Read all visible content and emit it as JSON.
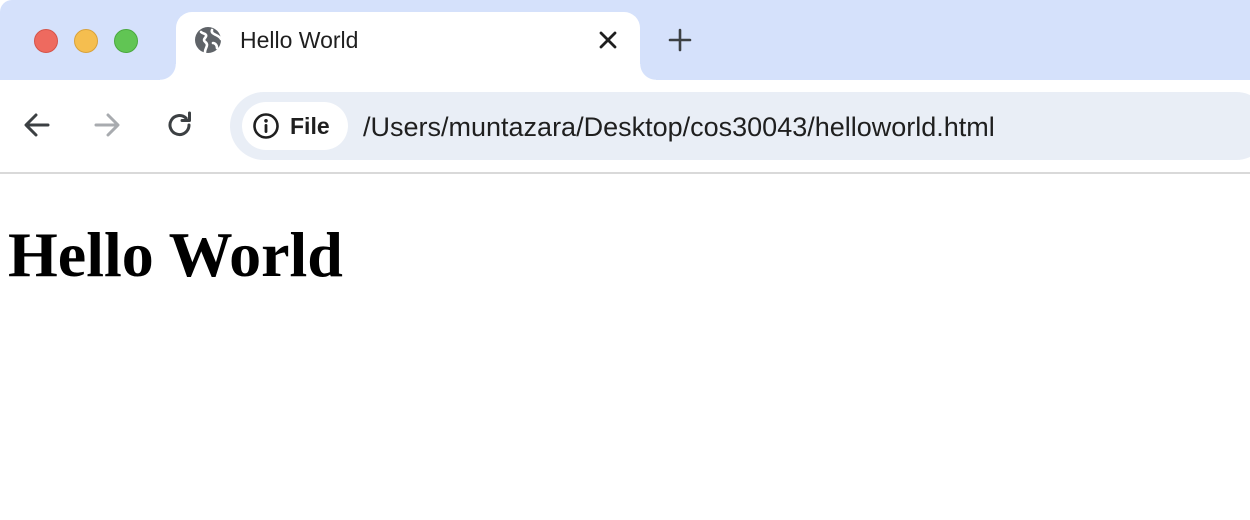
{
  "tab": {
    "title": "Hello World",
    "favicon": "globe-icon"
  },
  "toolbar": {
    "back_icon": "arrow-left-icon",
    "forward_icon": "arrow-right-icon",
    "reload_icon": "reload-icon"
  },
  "omnibox": {
    "chip_icon": "info-icon",
    "chip_label": "File",
    "url": "/Users/muntazara/Desktop/cos30043/helloworld.html"
  },
  "page": {
    "heading": "Hello World"
  },
  "colors": {
    "tabstrip_bg": "#d5e1fb",
    "omnibox_bg": "#e9eef6",
    "traffic_close": "#ee6a5f",
    "traffic_minimize": "#f5be4f",
    "traffic_maximize": "#61c554"
  }
}
